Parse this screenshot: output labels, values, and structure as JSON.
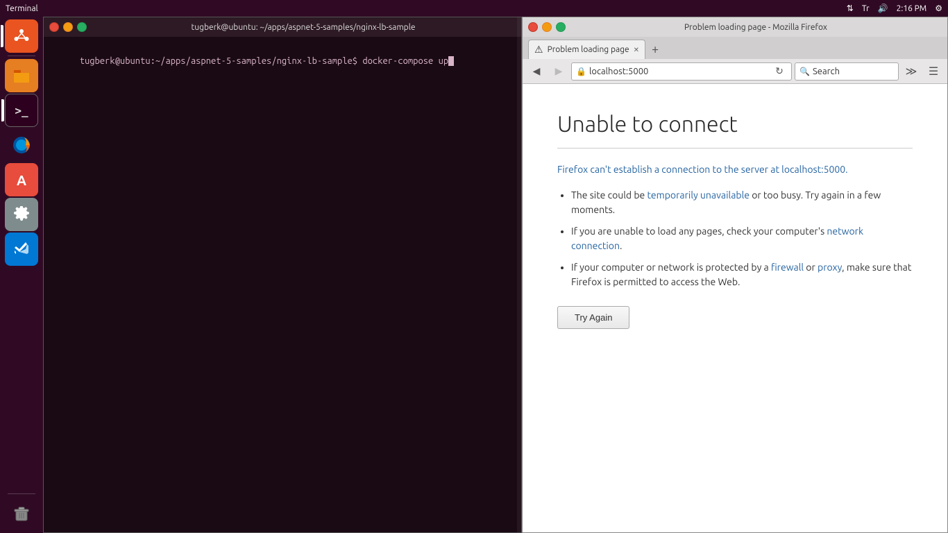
{
  "system_bar": {
    "title": "Terminal",
    "time": "2:16 PM",
    "icons": [
      "⇅",
      "Tr",
      "🔊"
    ]
  },
  "launcher": {
    "items": [
      {
        "id": "ubuntu",
        "label": "Ubuntu",
        "icon": "🐧",
        "style": "ubuntu-icon",
        "active": true
      },
      {
        "id": "files",
        "label": "Files",
        "icon": "📁",
        "style": "files-icon",
        "active": false
      },
      {
        "id": "terminal",
        "label": "Terminal",
        "icon": ">_",
        "style": "terminal-icon",
        "active": true
      },
      {
        "id": "firefox",
        "label": "Firefox",
        "icon": "🦊",
        "style": "firefox-icon",
        "active": false
      },
      {
        "id": "texteditor",
        "label": "Text Editor",
        "icon": "A",
        "style": "texteditor-icon",
        "active": false
      },
      {
        "id": "settings",
        "label": "Settings",
        "icon": "⚙",
        "style": "settings-icon",
        "active": false
      },
      {
        "id": "vscode",
        "label": "VS Code",
        "icon": "≺≻",
        "style": "vscode-icon",
        "active": false
      },
      {
        "id": "trash",
        "label": "Trash",
        "icon": "🗑",
        "style": "trash-icon",
        "active": false
      }
    ]
  },
  "terminal": {
    "title": "tugberk@ubuntu: ~/apps/aspnet-5-samples/nginx-lb-sample",
    "prompt_line": "tugberk@ubuntu:~/apps/aspnet-5-samples/nginx-lb-sample$ docker-compose up",
    "bg_color": "#1a0a14"
  },
  "firefox": {
    "title": "Problem loading page - Mozilla Firefox",
    "tab": {
      "label": "Problem loading page",
      "icon": "⚠"
    },
    "toolbar": {
      "url": "localhost:5000",
      "search_placeholder": "Search",
      "back_disabled": false,
      "forward_disabled": true
    },
    "error_page": {
      "heading": "Unable to connect",
      "description": "Firefox can't establish a connection to the server at localhost:5000.",
      "bullets": [
        "The site could be temporarily unavailable or too busy. Try again in a few moments.",
        "If you are unable to load any pages, check your computer's network connection.",
        "If your computer or network is protected by a firewall or proxy, make sure that Firefox is permitted to access the Web."
      ],
      "try_again_label": "Try Again",
      "link_texts": {
        "temporarily_unavailable": "temporarily unavailable",
        "network_connection": "network connection",
        "firewall": "firewall",
        "proxy": "proxy"
      }
    }
  }
}
